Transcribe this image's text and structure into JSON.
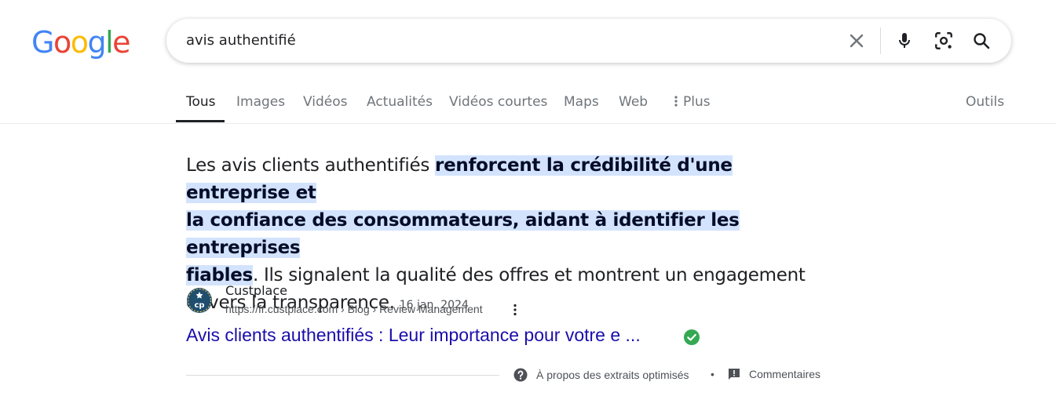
{
  "logo": {
    "letters": [
      "G",
      "o",
      "o",
      "g",
      "l",
      "e"
    ],
    "colors": [
      "#4285F4",
      "#EA4335",
      "#FBBC05",
      "#4285F4",
      "#34A853",
      "#EA4335"
    ]
  },
  "search": {
    "query": "avis authentifié",
    "icons": [
      "close-icon",
      "mic-icon",
      "lens-icon",
      "search-icon"
    ]
  },
  "tabs": [
    {
      "label": "Tous",
      "active": true
    },
    {
      "label": "Images",
      "active": false
    },
    {
      "label": "Vidéos",
      "active": false
    },
    {
      "label": "Actualités",
      "active": false
    },
    {
      "label": "Vidéos courtes",
      "active": false
    },
    {
      "label": "Maps",
      "active": false
    },
    {
      "label": "Web",
      "active": false
    },
    {
      "label": "Plus",
      "active": false
    }
  ],
  "tools_label": "Outils",
  "snippet": {
    "intro": "Les avis clients authentifiés ",
    "highlight_1": "renforcent la crédibilité d'une entreprise et",
    "highlight_2": "la confiance des consommateurs, aidant à identifier les entreprises",
    "highlight_3": "fiables",
    "rest_1": ". Ils signalent la qualité des offres et montrent un engagement",
    "rest_2": "envers la transparence.",
    "date": "16 jan. 2024"
  },
  "source": {
    "name": "Custplace",
    "url": "https://fr.custplace.com › Blog › Review Management",
    "favicon_text": "cp",
    "title": "Avis clients authentifiés : Leur importance pour votre e ..."
  },
  "footer": {
    "about": "À propos des extraits optimisés",
    "separator": "•",
    "feedback": "Commentaires"
  },
  "colors": {
    "link": "#1a0dab",
    "highlight_bg": "#d3e3fd",
    "verified": "#34a853",
    "favicon_bg": "#1f4e6e"
  }
}
